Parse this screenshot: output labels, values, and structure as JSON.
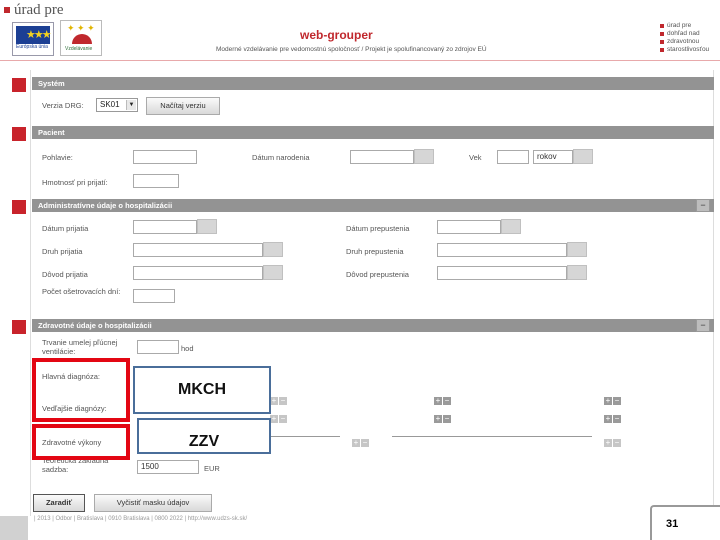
{
  "header": {
    "brand": "úrad pre",
    "app_title": "web-grouper",
    "subtitle": "Moderné vzdelávanie pre vedomostnú spoločnosť / Projekt je spolufinancovaný zo zdrojov EÚ",
    "logos": {
      "eu_caption": "Európska únia",
      "op_caption": "Vzdelávanie"
    },
    "right_list": [
      "úrad pre",
      "dohľad nad",
      "zdravotnou",
      "starostlivosťou"
    ]
  },
  "sections": {
    "system": {
      "title": "Systém",
      "version_label": "Verzia DRG:",
      "version_value": "SK01",
      "load_button": "Načítaj verziu"
    },
    "patient": {
      "title": "Pacient",
      "sex_label": "Pohlavie:",
      "birth_label": "Dátum narodenia",
      "age_label": "Vek",
      "age_unit": "rokov",
      "weight_label": "Hmotnosť pri prijatí:"
    },
    "admin": {
      "title": "Administratívne údaje o hospitalizácii",
      "admission_date_label": "Dátum prijatia",
      "discharge_date_label": "Dátum prepustenia",
      "admission_type_label": "Druh prijatia",
      "discharge_type_label": "Druh prepustenia",
      "admission_reason_label": "Dôvod prijatia",
      "discharge_reason_label": "Dôvod prepustenia",
      "care_days_label": "Počet ošetrovacích dní:"
    },
    "health": {
      "title": "Zdravotné údaje o hospitalizácii",
      "ventilation_label": "Trvanie umelej pľúcnej ventilácie:",
      "ventilation_unit": "hod",
      "main_diag_label": "Hlavná diagnóza:",
      "secondary_diag_label": "Vedľajšie diagnózy:",
      "procedures_label": "Zdravotné výkony",
      "base_rate_label": "Teoretická základná sadzba:",
      "base_rate_value": "1500",
      "base_rate_unit": "EUR"
    }
  },
  "overlays": {
    "mkch": "MKCH",
    "zzv": "ZZV"
  },
  "actions": {
    "classify": "Zaradiť",
    "clear": "Vyčistiť masku údajov"
  },
  "footer": {
    "text": "| 2013 | Odbor | Bratislava | 0910 Bratislava | 0800 2022 | http://www.udzs-sk.sk/",
    "slide_number": "31"
  },
  "icons": {
    "plus": "+",
    "minus": "−",
    "toggle": "−"
  },
  "colors": {
    "accent_red": "#c8232b",
    "section_gray": "#939393",
    "frame_red": "#e30613",
    "overlay_blue": "#4a6e9a"
  }
}
